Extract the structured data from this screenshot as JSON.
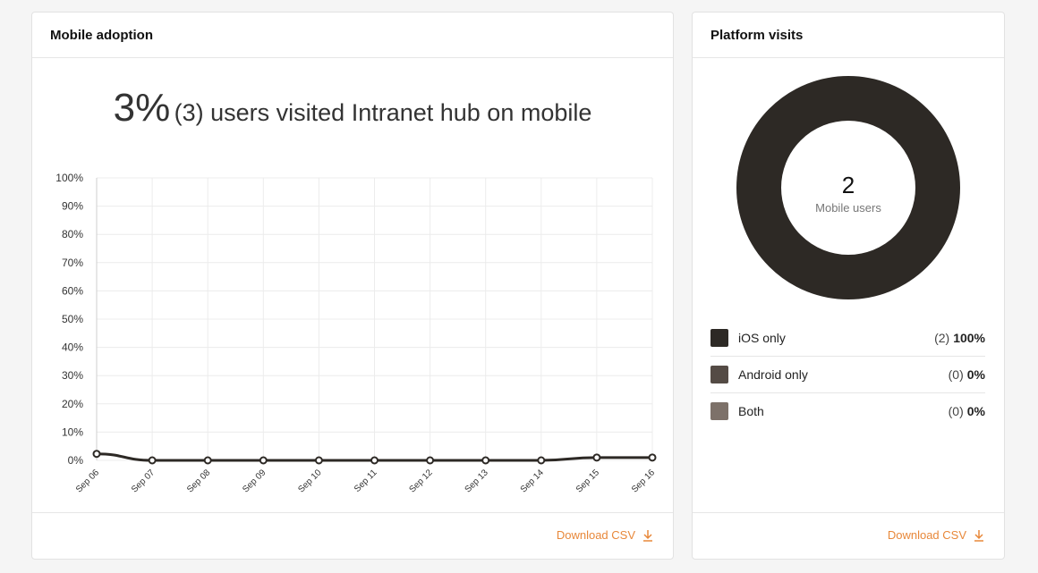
{
  "mobile_adoption": {
    "title": "Mobile adoption",
    "headline_percent": "3%",
    "headline_text": "(3) users visited Intranet hub on mobile",
    "download_label": "Download CSV"
  },
  "platform_visits": {
    "title": "Platform visits",
    "total": "2",
    "total_label": "Mobile users",
    "download_label": "Download CSV",
    "legend": [
      {
        "label": "iOS only",
        "count": "(2)",
        "percent": "100%",
        "color": "#2d2925"
      },
      {
        "label": "Android only",
        "count": "(0)",
        "percent": "0%",
        "color": "#544b45"
      },
      {
        "label": "Both",
        "count": "(0)",
        "percent": "0%",
        "color": "#7d7169"
      }
    ]
  },
  "chart_data": [
    {
      "type": "line",
      "title": "Mobile adoption",
      "x": [
        "Sep 06",
        "Sep 07",
        "Sep 08",
        "Sep 09",
        "Sep 10",
        "Sep 11",
        "Sep 12",
        "Sep 13",
        "Sep 14",
        "Sep 15",
        "Sep 16"
      ],
      "series": [
        {
          "name": "Mobile adoption",
          "values": [
            2.3,
            0,
            0,
            0,
            0,
            0,
            0,
            0,
            0,
            1,
            1
          ],
          "color": "#2d2925"
        }
      ],
      "yticks": [
        "0%",
        "10%",
        "20%",
        "30%",
        "40%",
        "50%",
        "60%",
        "70%",
        "80%",
        "90%",
        "100%"
      ],
      "ylim": [
        0,
        100
      ],
      "xlabel": "",
      "ylabel": "",
      "grid": true
    },
    {
      "type": "pie",
      "title": "Platform visits",
      "categories": [
        "iOS only",
        "Android only",
        "Both"
      ],
      "values": [
        2,
        0,
        0
      ],
      "colors": [
        "#2d2925",
        "#544b45",
        "#7d7169"
      ]
    }
  ]
}
